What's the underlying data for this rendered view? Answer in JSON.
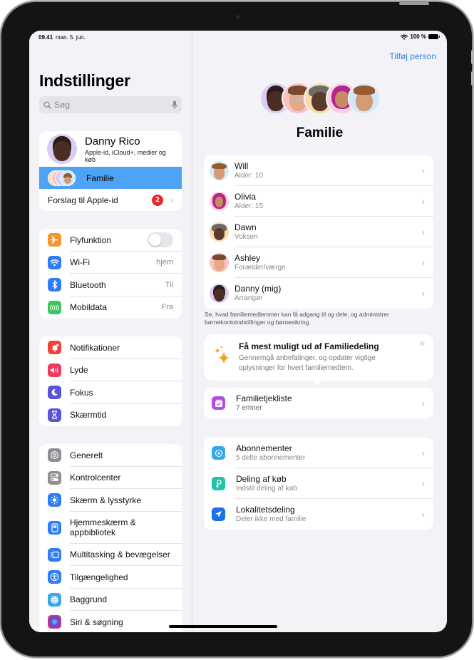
{
  "status_bar": {
    "time": "09.41",
    "date": "man. 5. jun.",
    "battery": "100 %",
    "wifi_icon": "wifi-icon",
    "battery_icon": "battery-icon"
  },
  "sidebar": {
    "title": "Indstillinger",
    "search": {
      "placeholder": "Søg",
      "icon": "search-icon",
      "mic_icon": "microphone-icon"
    },
    "profile": {
      "name": "Danny Rico",
      "subtitle": "Apple-id, iCloud+, medier og køb"
    },
    "family": {
      "label": "Familie",
      "selected": true
    },
    "suggestions": {
      "label": "Forslag til Apple-id",
      "badge": "2"
    },
    "connectivity": [
      {
        "label": "Flyfunktion",
        "icon": "airplane-icon",
        "color": "#f7952e",
        "toggle": false
      },
      {
        "label": "Wi-Fi",
        "icon": "wifi-icon",
        "color": "#2f7df6",
        "value": "hjem"
      },
      {
        "label": "Bluetooth",
        "icon": "bluetooth-icon",
        "color": "#2f7df6",
        "value": "Til"
      },
      {
        "label": "Mobildata",
        "icon": "antenna-icon",
        "color": "#3bc45a",
        "value": "Fra"
      }
    ],
    "notifications": [
      {
        "label": "Notifikationer",
        "icon": "bell-icon",
        "color": "#f0433a"
      },
      {
        "label": "Lyde",
        "icon": "speaker-icon",
        "color": "#f23a5d"
      },
      {
        "label": "Fokus",
        "icon": "moon-icon",
        "color": "#5856d6"
      },
      {
        "label": "Skærmtid",
        "icon": "hourglass-icon",
        "color": "#5856d6"
      }
    ],
    "general": [
      {
        "label": "Generelt",
        "icon": "gear-icon",
        "color": "#8e8e93"
      },
      {
        "label": "Kontrolcenter",
        "icon": "switches-icon",
        "color": "#8e8e93"
      },
      {
        "label": "Skærm & lysstyrke",
        "icon": "sun-icon",
        "color": "#2f7df6"
      },
      {
        "label": "Hjemmeskærm & appbibliotek",
        "icon": "home-screen-icon",
        "color": "#2f7df6"
      },
      {
        "label": "Multitasking & bevægelser",
        "icon": "multitasking-icon",
        "color": "#2f7df6"
      },
      {
        "label": "Tilgængelighed",
        "icon": "accessibility-icon",
        "color": "#2f7df6"
      },
      {
        "label": "Baggrund",
        "icon": "flower-icon",
        "color": "#3aa8e8"
      },
      {
        "label": "Siri & søgning",
        "icon": "siri-icon",
        "color": "#222222"
      }
    ]
  },
  "detail": {
    "add_person": "Tilføj person",
    "title": "Familie",
    "members": [
      {
        "name": "Will",
        "role": "Alder: 10",
        "bg": "#cfe9fb"
      },
      {
        "name": "Olivia",
        "role": "Alder: 15",
        "bg": "#fbcfe0"
      },
      {
        "name": "Dawn",
        "role": "Voksen",
        "bg": "#fbdca8"
      },
      {
        "name": "Ashley",
        "role": "Forælder/værge",
        "bg": "#f9c2c2"
      },
      {
        "name": "Danny (mig)",
        "role": "Arrangør",
        "bg": "#dccdf4"
      }
    ],
    "footnote": "Se, hvad familiemedlemmer kan få adgang til og dele, og administrer børnekontoindstillinger og børnesikring.",
    "tip": {
      "title": "Få mest muligt ud af Familiedeling",
      "description": "Gennemgå anbefalinger, og opdater vigtige oplysninger for hvert familiemedlem.",
      "icon": "sparkles-icon",
      "close_icon": "close-icon"
    },
    "checklist": {
      "title": "Familietjekliste",
      "subtitle": "7 emner",
      "icon": "checklist-icon",
      "color": "#b050e0"
    },
    "sharing": [
      {
        "title": "Abonnementer",
        "subtitle": "5 delte abonnementer",
        "icon": "subscriptions-icon",
        "color": "#34a8e8"
      },
      {
        "title": "Deling af køb",
        "subtitle": "Indstil deling af køb",
        "icon": "purchase-sharing-icon",
        "color": "#21c4a8"
      },
      {
        "title": "Lokalitetsdeling",
        "subtitle": "Deler ikke med familie",
        "icon": "location-arrow-icon",
        "color": "#1a72f0"
      }
    ]
  },
  "colors": {
    "accent": "#2b7ff0",
    "selection": "#4ea3f6",
    "background": "#f2f2f7"
  }
}
